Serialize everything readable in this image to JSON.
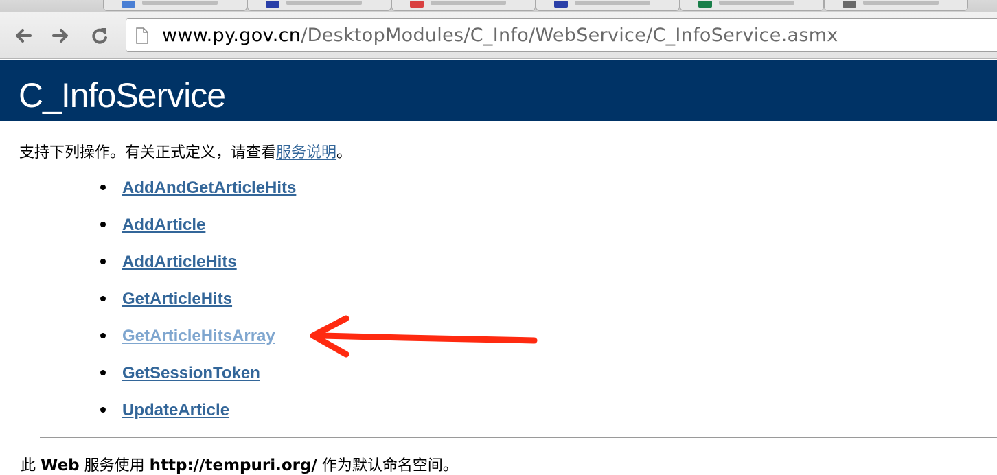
{
  "browser": {
    "tabs": [
      {
        "favicon_color": "#4a7fd4"
      },
      {
        "favicon_color": "#2a3fa8"
      },
      {
        "favicon_color": "#d94040"
      },
      {
        "favicon_color": "#2a3fa8"
      },
      {
        "favicon_color": "#1a7f4a"
      },
      {
        "favicon_color": "#6a6a6a"
      }
    ],
    "url_host": "www.py.gov.cn",
    "url_path": "/DesktopModules/C_Info/WebService/C_InfoService.asmx"
  },
  "page": {
    "title": "C_InfoService",
    "intro_text": "支持下列操作。有关正式定义，请查看",
    "intro_link": "服务说明",
    "intro_end": "。",
    "operations": [
      {
        "label": "AddAndGetArticleHits",
        "visited": false
      },
      {
        "label": "AddArticle",
        "visited": false
      },
      {
        "label": "AddArticleHits",
        "visited": false
      },
      {
        "label": "GetArticleHits",
        "visited": false
      },
      {
        "label": "GetArticleHitsArray",
        "visited": true
      },
      {
        "label": "GetSessionToken",
        "visited": false
      },
      {
        "label": "UpdateArticle",
        "visited": false
      }
    ],
    "namespace_prefix": "此",
    "namespace_web": "Web",
    "namespace_mid": "服务使用",
    "namespace_uri": "http://tempuri.org/",
    "namespace_suffix": "作为默认命名空间。"
  },
  "colors": {
    "banner": "#003366",
    "link": "#336699",
    "visited_link": "#7fa6cf",
    "annotation_arrow": "#ff2a10"
  }
}
